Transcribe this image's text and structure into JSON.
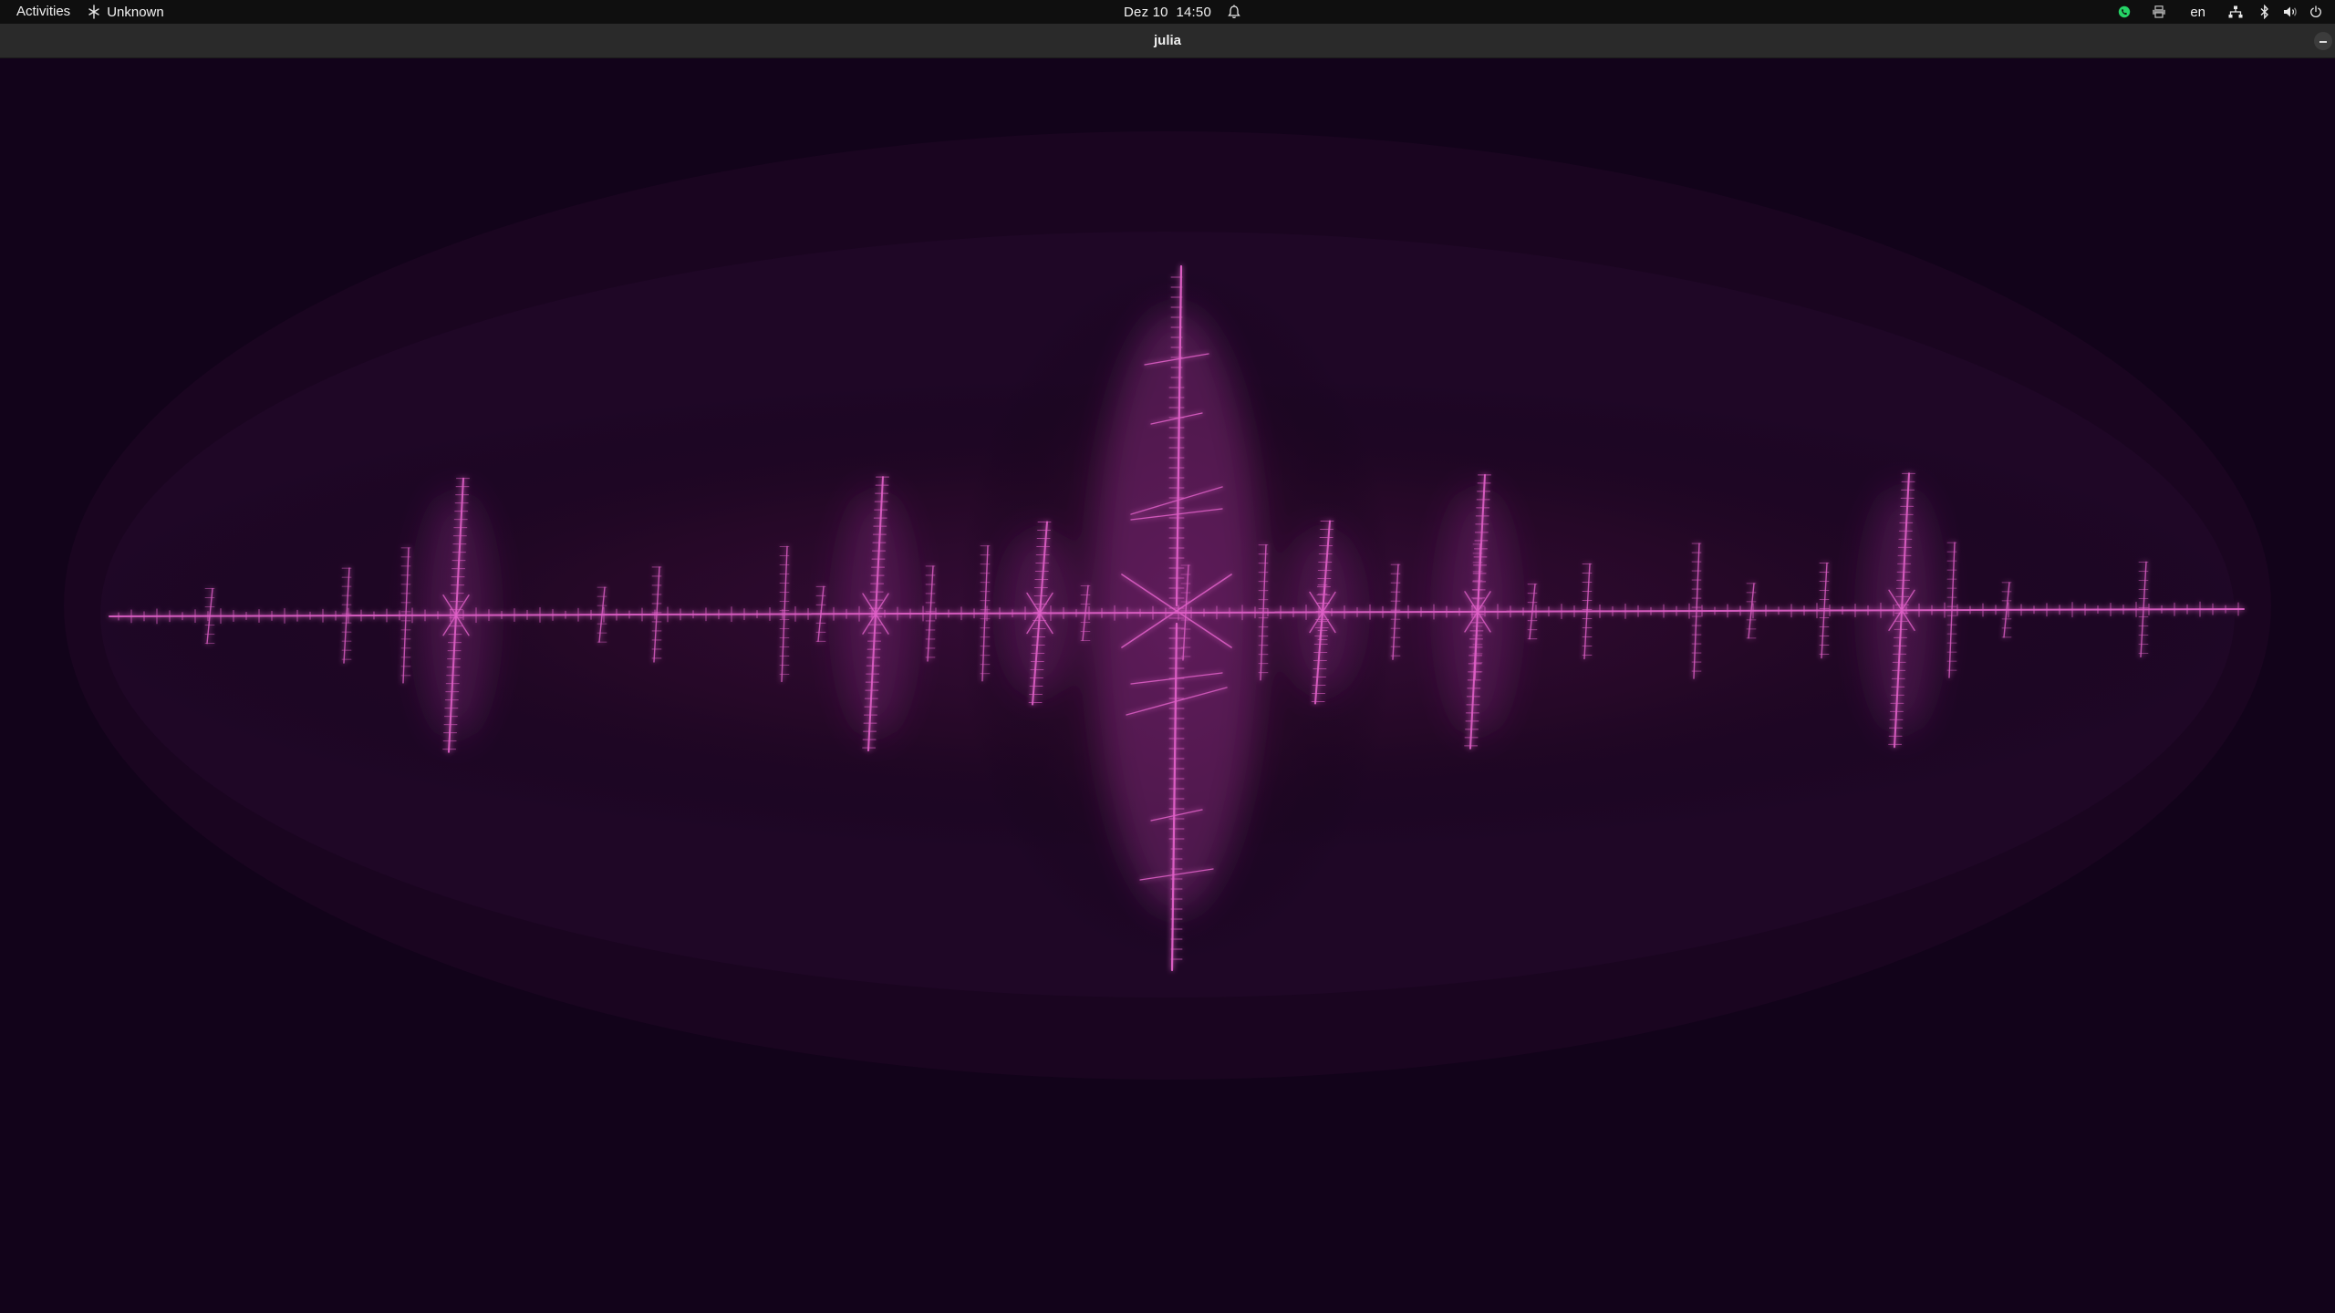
{
  "topbar": {
    "activities_label": "Activities",
    "app_name": "Unknown",
    "clock": "Dez 10  14:50",
    "language": "en",
    "tray_icons": [
      "whatsapp-icon",
      "printer-icon",
      "network-icon",
      "bluetooth-icon",
      "volume-icon",
      "power-icon"
    ]
  },
  "window": {
    "title": "julia"
  },
  "colors": {
    "background": "#12031a",
    "fractal": "#e060c8",
    "glow": "#8a2a80",
    "whatsapp": "#25d366"
  }
}
